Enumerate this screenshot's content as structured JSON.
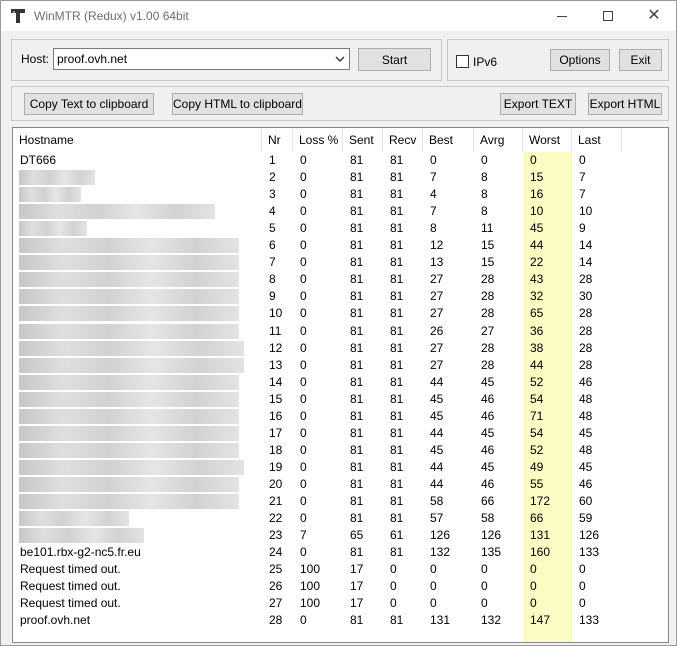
{
  "window": {
    "title": "WinMTR (Redux) v1.00 64bit"
  },
  "controls": {
    "host_label": "Host:",
    "host_value": "proof.ovh.net",
    "start_label": "Start",
    "ipv6_label": "IPv6",
    "ipv6_checked": false,
    "options_label": "Options",
    "exit_label": "Exit",
    "copy_text_label": "Copy Text to clipboard",
    "copy_html_label": "Copy HTML to clipboard",
    "export_text_label": "Export TEXT",
    "export_html_label": "Export HTML"
  },
  "table": {
    "columns": [
      "Hostname",
      "Nr",
      "Loss %",
      "Sent",
      "Recv",
      "Best",
      "Avrg",
      "Worst",
      "Last"
    ],
    "rows": [
      {
        "host": "DT666",
        "redacted": false,
        "nr": "1",
        "loss": "0",
        "sent": "81",
        "recv": "81",
        "best": "0",
        "avrg": "0",
        "worst": "0",
        "last": "0"
      },
      {
        "host": "",
        "redacted": true,
        "nr": "2",
        "loss": "0",
        "sent": "81",
        "recv": "81",
        "best": "7",
        "avrg": "8",
        "worst": "15",
        "last": "7"
      },
      {
        "host": "",
        "redacted": true,
        "nr": "3",
        "loss": "0",
        "sent": "81",
        "recv": "81",
        "best": "4",
        "avrg": "8",
        "worst": "16",
        "last": "7"
      },
      {
        "host": "",
        "redacted": true,
        "nr": "4",
        "loss": "0",
        "sent": "81",
        "recv": "81",
        "best": "7",
        "avrg": "8",
        "worst": "10",
        "last": "10"
      },
      {
        "host": "",
        "redacted": true,
        "nr": "5",
        "loss": "0",
        "sent": "81",
        "recv": "81",
        "best": "8",
        "avrg": "11",
        "worst": "45",
        "last": "9"
      },
      {
        "host": "",
        "redacted": true,
        "nr": "6",
        "loss": "0",
        "sent": "81",
        "recv": "81",
        "best": "12",
        "avrg": "15",
        "worst": "44",
        "last": "14"
      },
      {
        "host": "",
        "redacted": true,
        "nr": "7",
        "loss": "0",
        "sent": "81",
        "recv": "81",
        "best": "13",
        "avrg": "15",
        "worst": "22",
        "last": "14"
      },
      {
        "host": "",
        "redacted": true,
        "nr": "8",
        "loss": "0",
        "sent": "81",
        "recv": "81",
        "best": "27",
        "avrg": "28",
        "worst": "43",
        "last": "28"
      },
      {
        "host": "",
        "redacted": true,
        "nr": "9",
        "loss": "0",
        "sent": "81",
        "recv": "81",
        "best": "27",
        "avrg": "28",
        "worst": "32",
        "last": "30"
      },
      {
        "host": "",
        "redacted": true,
        "nr": "10",
        "loss": "0",
        "sent": "81",
        "recv": "81",
        "best": "27",
        "avrg": "28",
        "worst": "65",
        "last": "28"
      },
      {
        "host": "",
        "redacted": true,
        "nr": "11",
        "loss": "0",
        "sent": "81",
        "recv": "81",
        "best": "26",
        "avrg": "27",
        "worst": "36",
        "last": "28"
      },
      {
        "host": "",
        "redacted": true,
        "nr": "12",
        "loss": "0",
        "sent": "81",
        "recv": "81",
        "best": "27",
        "avrg": "28",
        "worst": "38",
        "last": "28"
      },
      {
        "host": "",
        "redacted": true,
        "nr": "13",
        "loss": "0",
        "sent": "81",
        "recv": "81",
        "best": "27",
        "avrg": "28",
        "worst": "44",
        "last": "28"
      },
      {
        "host": "",
        "redacted": true,
        "nr": "14",
        "loss": "0",
        "sent": "81",
        "recv": "81",
        "best": "44",
        "avrg": "45",
        "worst": "52",
        "last": "46"
      },
      {
        "host": "",
        "redacted": true,
        "nr": "15",
        "loss": "0",
        "sent": "81",
        "recv": "81",
        "best": "45",
        "avrg": "46",
        "worst": "54",
        "last": "48"
      },
      {
        "host": "",
        "redacted": true,
        "nr": "16",
        "loss": "0",
        "sent": "81",
        "recv": "81",
        "best": "45",
        "avrg": "46",
        "worst": "71",
        "last": "48"
      },
      {
        "host": "",
        "redacted": true,
        "nr": "17",
        "loss": "0",
        "sent": "81",
        "recv": "81",
        "best": "44",
        "avrg": "45",
        "worst": "54",
        "last": "45"
      },
      {
        "host": "",
        "redacted": true,
        "nr": "18",
        "loss": "0",
        "sent": "81",
        "recv": "81",
        "best": "45",
        "avrg": "46",
        "worst": "52",
        "last": "48"
      },
      {
        "host": "",
        "redacted": true,
        "nr": "19",
        "loss": "0",
        "sent": "81",
        "recv": "81",
        "best": "44",
        "avrg": "45",
        "worst": "49",
        "last": "45"
      },
      {
        "host": "",
        "redacted": true,
        "nr": "20",
        "loss": "0",
        "sent": "81",
        "recv": "81",
        "best": "44",
        "avrg": "46",
        "worst": "55",
        "last": "46"
      },
      {
        "host": "",
        "redacted": true,
        "nr": "21",
        "loss": "0",
        "sent": "81",
        "recv": "81",
        "best": "58",
        "avrg": "66",
        "worst": "172",
        "last": "60"
      },
      {
        "host": "",
        "redacted": true,
        "nr": "22",
        "loss": "0",
        "sent": "81",
        "recv": "81",
        "best": "57",
        "avrg": "58",
        "worst": "66",
        "last": "59"
      },
      {
        "host": "",
        "redacted": true,
        "nr": "23",
        "loss": "7",
        "sent": "65",
        "recv": "61",
        "best": "126",
        "avrg": "126",
        "worst": "131",
        "last": "126"
      },
      {
        "host": "be101.rbx-g2-nc5.fr.eu",
        "redacted": false,
        "nr": "24",
        "loss": "0",
        "sent": "81",
        "recv": "81",
        "best": "132",
        "avrg": "135",
        "worst": "160",
        "last": "133"
      },
      {
        "host": "Request timed out.",
        "redacted": false,
        "nr": "25",
        "loss": "100",
        "sent": "17",
        "recv": "0",
        "best": "0",
        "avrg": "0",
        "worst": "0",
        "last": "0"
      },
      {
        "host": "Request timed out.",
        "redacted": false,
        "nr": "26",
        "loss": "100",
        "sent": "17",
        "recv": "0",
        "best": "0",
        "avrg": "0",
        "worst": "0",
        "last": "0"
      },
      {
        "host": "Request timed out.",
        "redacted": false,
        "nr": "27",
        "loss": "100",
        "sent": "17",
        "recv": "0",
        "best": "0",
        "avrg": "0",
        "worst": "0",
        "last": "0"
      },
      {
        "host": "proof.ovh.net",
        "redacted": false,
        "nr": "28",
        "loss": "0",
        "sent": "81",
        "recv": "81",
        "best": "131",
        "avrg": "132",
        "worst": "147",
        "last": "133"
      }
    ]
  },
  "colors": {
    "worst_highlight": "#fbfcc4",
    "window_bg": "#f0f0f0"
  }
}
